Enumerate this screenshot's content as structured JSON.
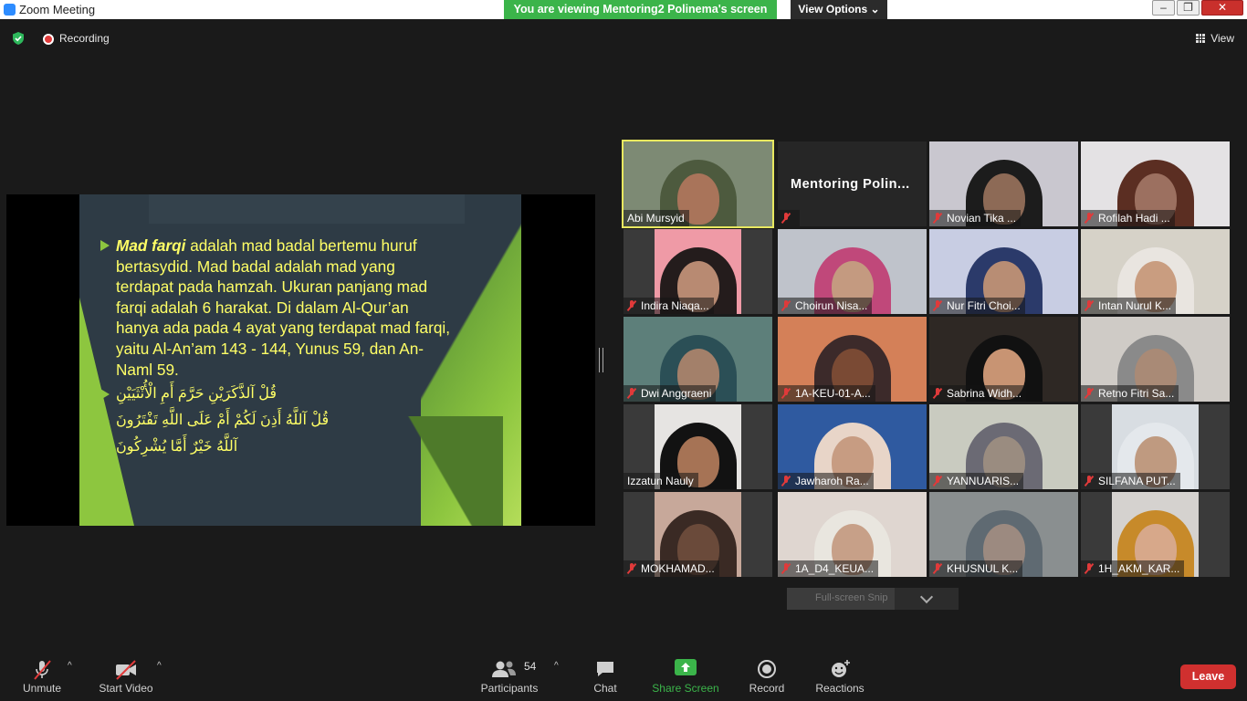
{
  "window": {
    "title": "Zoom Meeting",
    "banner": "You are viewing Mentoring2 Polinema's screen",
    "view_options": "View Options",
    "min": "–",
    "max": "❐",
    "close": "✕"
  },
  "status": {
    "recording": "Recording",
    "view": "View"
  },
  "slide": {
    "bold_term": "Mad farqi",
    "lines": [
      "adalah mad badal bertemu huruf",
      "bertasydid. Mad badal adalah mad yang",
      "terdapat pada hamzah. Ukuran panjang mad",
      "farqi adalah 6 harakat. Di dalam Al-Qur’an",
      "hanya ada pada 4 ayat yang terdapat mad farqi,",
      "yaitu Al-An’am 143 - 144, Yunus  59, dan An-",
      "Naml 59."
    ],
    "arabic": [
      "قُلْ آلذَّكَرَيْنِ حَرَّمَ أَمِ الْأُنْثَيَيْنِ",
      "قُلْ آللَّهُ أَذِنَ لَكُمْ أَمْ عَلَى اللَّهِ تَفْتَرُونَ",
      "آللَّهُ خَيْرٌ أَمَّا يُشْرِكُونَ"
    ]
  },
  "participants": [
    {
      "name": "Abi Mursyid",
      "muted": false,
      "active": true,
      "bg": "#7d8a74",
      "skin": "#a9745a",
      "hijab": "#4d5a3e"
    },
    {
      "name": "Mentoring  Polin...",
      "muted": true,
      "text_only": true
    },
    {
      "name": "Novian Tika ...",
      "muted": true,
      "bg": "#c9c7cf",
      "skin": "#8d6a56",
      "hijab": "#1c1c1c"
    },
    {
      "name": "Rofilah Hadi ...",
      "muted": true,
      "bg": "#e4e2e4",
      "skin": "#9c7060",
      "hijab": "#5b2e22"
    },
    {
      "name": "Indira Niaqa...",
      "muted": true,
      "bg": "#ef9aa6",
      "skin": "#b88a72",
      "hijab": "#241c1c",
      "narrow": true
    },
    {
      "name": "Choirun Nisa...",
      "muted": true,
      "bg": "#bfc3cb",
      "skin": "#c49a80",
      "hijab": "#c0487a"
    },
    {
      "name": "Nur Fitri Choi...",
      "muted": true,
      "bg": "#c8cde3",
      "skin": "#b88d74",
      "hijab": "#2b3a6a"
    },
    {
      "name": "Intan Nurul K...",
      "muted": true,
      "bg": "#d6d2c8",
      "skin": "#c99d80",
      "hijab": "#e9e5e0"
    },
    {
      "name": "Dwi Anggraeni",
      "muted": true,
      "bg": "#5d7f7a",
      "skin": "#a3806a",
      "hijab": "#2b4f56"
    },
    {
      "name": "1A-KEU-01-A...",
      "muted": true,
      "bg": "#d48058",
      "skin": "#7a4a34",
      "hijab": "#3c2a2a"
    },
    {
      "name": "Sabrina Widh...",
      "muted": true,
      "bg": "#2e2824",
      "skin": "#c89473",
      "hijab": "#111111"
    },
    {
      "name": "Retno Fitri Sa...",
      "muted": true,
      "bg": "#cfcbc6",
      "skin": "#a98a76",
      "hijab": "#8a8a8a"
    },
    {
      "name": "Izzatun Nauly",
      "muted": false,
      "bg": "#e6e4e2",
      "skin": "#a67355",
      "hijab": "#121212",
      "narrow": true
    },
    {
      "name": "Jawharoh Ra...",
      "muted": true,
      "bg": "#2f5aa0",
      "skin": "#c79c82",
      "hijab": "#e8d5c8"
    },
    {
      "name": "YANNUARIS...",
      "muted": true,
      "bg": "#c9cbc0",
      "skin": "#9a8c80",
      "hijab": "#6b6a74"
    },
    {
      "name": "SILFANA PUT...",
      "muted": true,
      "bg": "#d8dde2",
      "skin": "#bf9a80",
      "hijab": "#e4e8ec",
      "narrow": true
    },
    {
      "name": "MOKHAMAD...",
      "muted": true,
      "bg": "#c7a89a",
      "skin": "#6a4a3a",
      "hijab": "#3a2a24",
      "narrow": true
    },
    {
      "name": "1A_D4_KEUA...",
      "muted": true,
      "bg": "#dfd6d0",
      "skin": "#c7a088",
      "hijab": "#e9e6df"
    },
    {
      "name": "KHUSNUL K...",
      "muted": true,
      "bg": "#8a8f90",
      "skin": "#9c8a80",
      "hijab": "#5f6a72"
    },
    {
      "name": "1H_AKM_KAR...",
      "muted": true,
      "bg": "#d5d2cf",
      "skin": "#d7a88a",
      "hijab": "#c78a2a",
      "narrow": true
    }
  ],
  "snip": {
    "label": "Full-screen Snip"
  },
  "toolbar": {
    "unmute": "Unmute",
    "start_video": "Start Video",
    "participants": "Participants",
    "participants_count": "54",
    "chat": "Chat",
    "share_screen": "Share Screen",
    "record": "Record",
    "reactions": "Reactions",
    "leave": "Leave",
    "caret": "^"
  },
  "colors": {
    "accent_green": "#3bb44a",
    "leave_red": "#d0302f",
    "slide_text": "#ffff66",
    "active_speaker": "#e8e860"
  }
}
